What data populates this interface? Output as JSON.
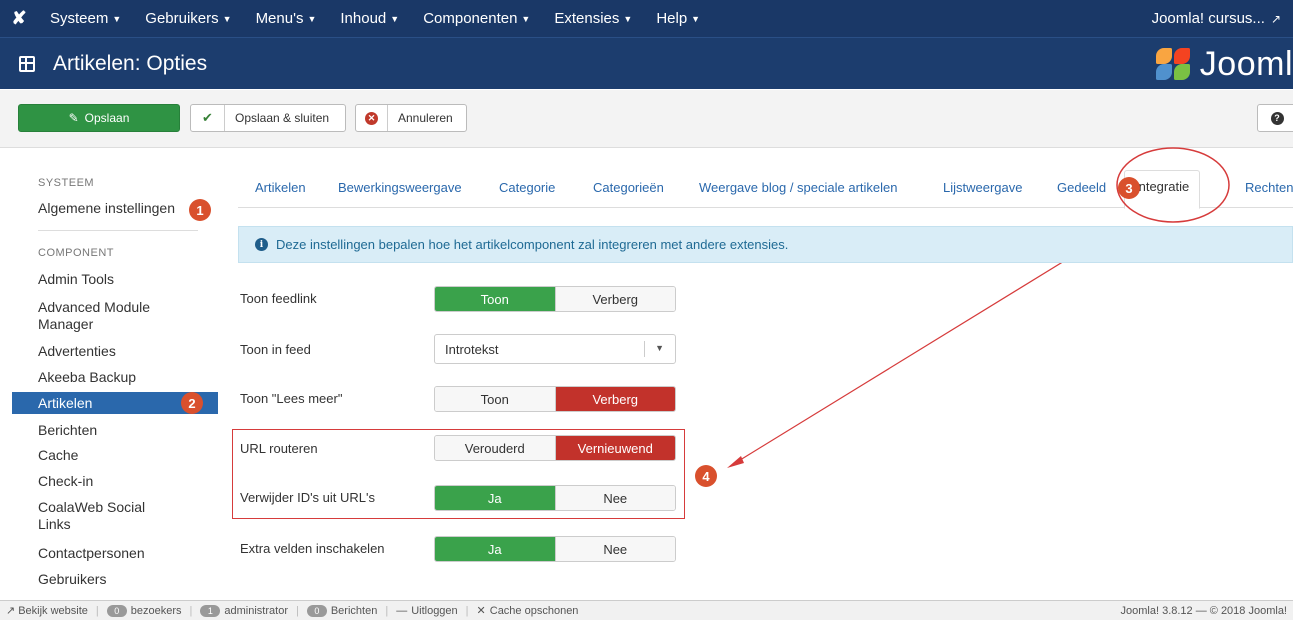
{
  "navbar": {
    "logo": "Joomla logo",
    "menu": [
      {
        "label": "Systeem"
      },
      {
        "label": "Gebruikers"
      },
      {
        "label": "Menu's"
      },
      {
        "label": "Inhoud"
      },
      {
        "label": "Componenten"
      },
      {
        "label": "Extensies"
      },
      {
        "label": "Help"
      }
    ],
    "site_link": "Joomla! cursus..."
  },
  "header": {
    "title": "Artikelen: Opties",
    "brand_text": "Jooml"
  },
  "toolbar": {
    "save_label": "Opslaan",
    "save_close_label": "Opslaan & sluiten",
    "cancel_label": "Annuleren",
    "help_icon": "?"
  },
  "sidebar": {
    "system_heading": "SYSTEEM",
    "system_item": "Algemene instellingen",
    "component_heading": "COMPONENT",
    "items": [
      {
        "label": "Admin Tools"
      },
      {
        "label": "Advanced Module Manager"
      },
      {
        "label": "Advertenties"
      },
      {
        "label": "Akeeba Backup"
      },
      {
        "label": "Artikelen"
      },
      {
        "label": "Berichten"
      },
      {
        "label": "Cache"
      },
      {
        "label": "Check-in"
      },
      {
        "label": "CoalaWeb Social Links"
      },
      {
        "label": "Contactpersonen"
      },
      {
        "label": "Gebruikers"
      }
    ]
  },
  "tabs": [
    {
      "label": "Artikelen"
    },
    {
      "label": "Bewerkingsweergave"
    },
    {
      "label": "Categorie"
    },
    {
      "label": "Categorieën"
    },
    {
      "label": "Weergave blog / speciale artikelen"
    },
    {
      "label": "Lijstweergave"
    },
    {
      "label": "Gedeeld"
    },
    {
      "label": "Integratie"
    },
    {
      "label": "Rechten"
    }
  ],
  "alert": {
    "icon": "i",
    "text": "Deze instellingen bepalen hoe het artikelcomponent zal integreren met andere extensies."
  },
  "form": {
    "feedlink": {
      "label": "Toon feedlink",
      "on": "Toon",
      "off": "Verberg",
      "selected": "Toon"
    },
    "in_feed": {
      "label": "Toon in feed",
      "value": "Introtekst"
    },
    "read_more": {
      "label": "Toon \"Lees meer\"",
      "on": "Toon",
      "off": "Verberg",
      "selected": "Verberg"
    },
    "url_routing": {
      "label": "URL routeren",
      "on": "Verouderd",
      "off": "Vernieuwend",
      "selected": "Vernieuwend"
    },
    "remove_ids": {
      "label": "Verwijder ID's uit URL's",
      "on": "Ja",
      "off": "Nee",
      "selected": "Ja"
    },
    "extra_fields": {
      "label": "Extra velden inschakelen",
      "on": "Ja",
      "off": "Nee",
      "selected": "Ja"
    }
  },
  "badges": [
    "1",
    "2",
    "3",
    "4"
  ],
  "statusbar": {
    "view_site": "Bekijk website",
    "visitors_count": "0",
    "visitors_label": "bezoekers",
    "admin_count": "1",
    "admin_label": "administrator",
    "messages_count": "0",
    "messages_label": "Berichten",
    "logout": "Uitloggen",
    "clear_cache": "Cache opschonen",
    "version": "Joomla! 3.8.12 — © 2018 Joomla!"
  },
  "colors": {
    "navbar": "#1a3867",
    "header": "#1c3d6e",
    "save_green": "#2f9344",
    "toggle_green": "#3aa24b",
    "toggle_red": "#c2322b",
    "active_blue": "#2a68ac",
    "annotation_red": "#d63b3b",
    "badge_orange": "#d9502d"
  }
}
